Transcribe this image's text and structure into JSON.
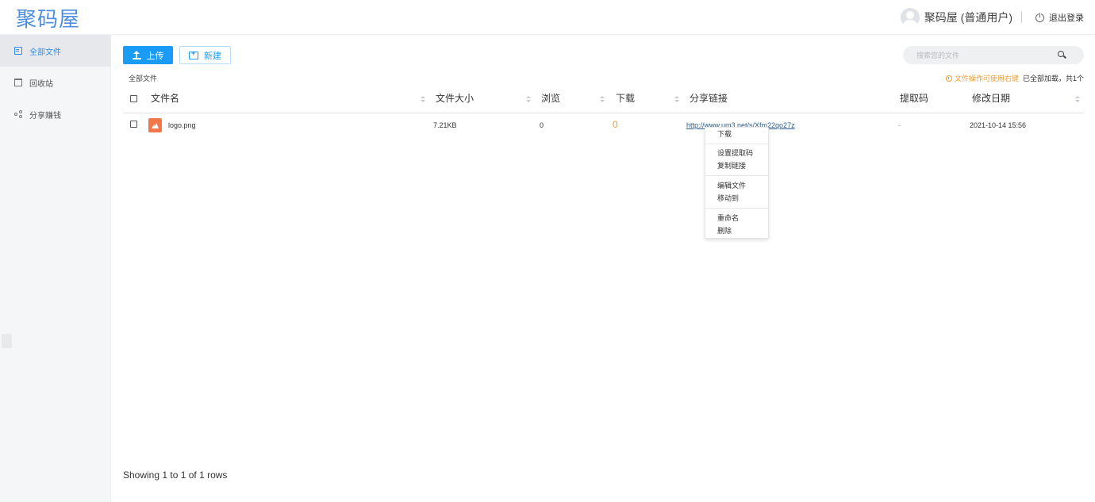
{
  "header": {
    "logo": "聚码屋",
    "user_name": "聚码屋 (普通用户)",
    "logout": "退出登录"
  },
  "sidebar": {
    "items": [
      {
        "label": "全部文件",
        "icon": "files-icon",
        "active": true
      },
      {
        "label": "回收站",
        "icon": "trash-icon",
        "active": false
      },
      {
        "label": "分享赚钱",
        "icon": "share-icon",
        "active": false
      }
    ]
  },
  "toolbar": {
    "upload_label": "上传",
    "new_label": "新建",
    "search_placeholder": "搜索您的文件"
  },
  "breadcrumb": "全部文件",
  "tip": {
    "warning": "文件操作可使用右键",
    "status": "已全部加载，共1个"
  },
  "table": {
    "columns": [
      "文件名",
      "文件大小",
      "浏览",
      "下载",
      "分享链接",
      "提取码",
      "修改日期"
    ],
    "rows": [
      {
        "name": "logo.png",
        "size": "7.21KB",
        "views": "0",
        "downloads": "0",
        "share_link": "http://www.um3.net/s/Xfm22qo27z",
        "code": "-",
        "modified": "2021-10-14 15:56"
      }
    ]
  },
  "context_menu": {
    "download": "下载",
    "set_code": "设置提取码",
    "copy_link": "复制链接",
    "edit": "编辑文件",
    "move": "移动到",
    "rename": "重命名",
    "delete": "删除"
  },
  "footer": "Showing 1 to 1 of 1 rows",
  "colors": {
    "accent": "#1a9bf5",
    "logo": "#4e8fe0",
    "warning": "#f39c2c",
    "file_icon": "#f2784b"
  }
}
